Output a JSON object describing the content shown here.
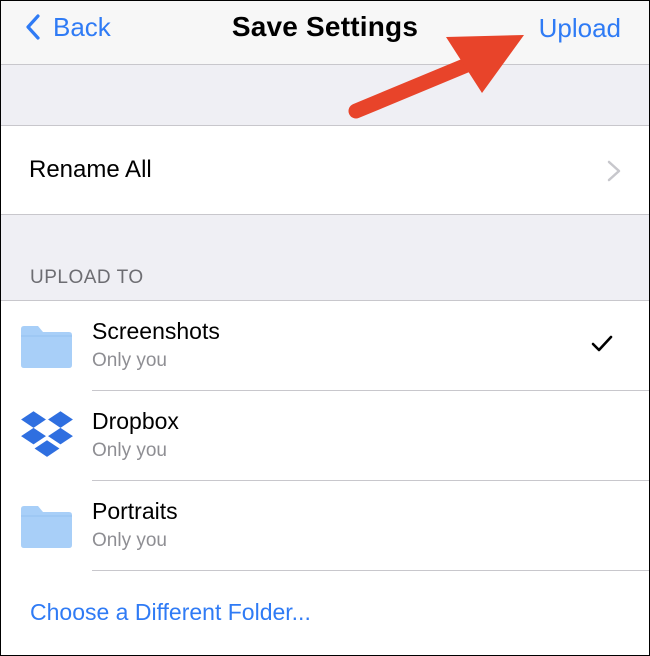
{
  "navbar": {
    "back_label": "Back",
    "title": "Save Settings",
    "upload_label": "Upload"
  },
  "rename": {
    "label": "Rename All"
  },
  "upload_to": {
    "header": "UPLOAD TO",
    "folders": [
      {
        "name": "Screenshots",
        "sub": "Only you",
        "icon": "folder-icon",
        "selected": true
      },
      {
        "name": "Dropbox",
        "sub": "Only you",
        "icon": "dropbox-icon",
        "selected": false
      },
      {
        "name": "Portraits",
        "sub": "Only you",
        "icon": "folder-icon",
        "selected": false
      }
    ],
    "choose_label": "Choose a Different Folder..."
  },
  "colors": {
    "accent": "#2f7bf5",
    "arrow": "#e8442a",
    "folder": "#a8cff8",
    "dropbox": "#2f6fe0"
  }
}
